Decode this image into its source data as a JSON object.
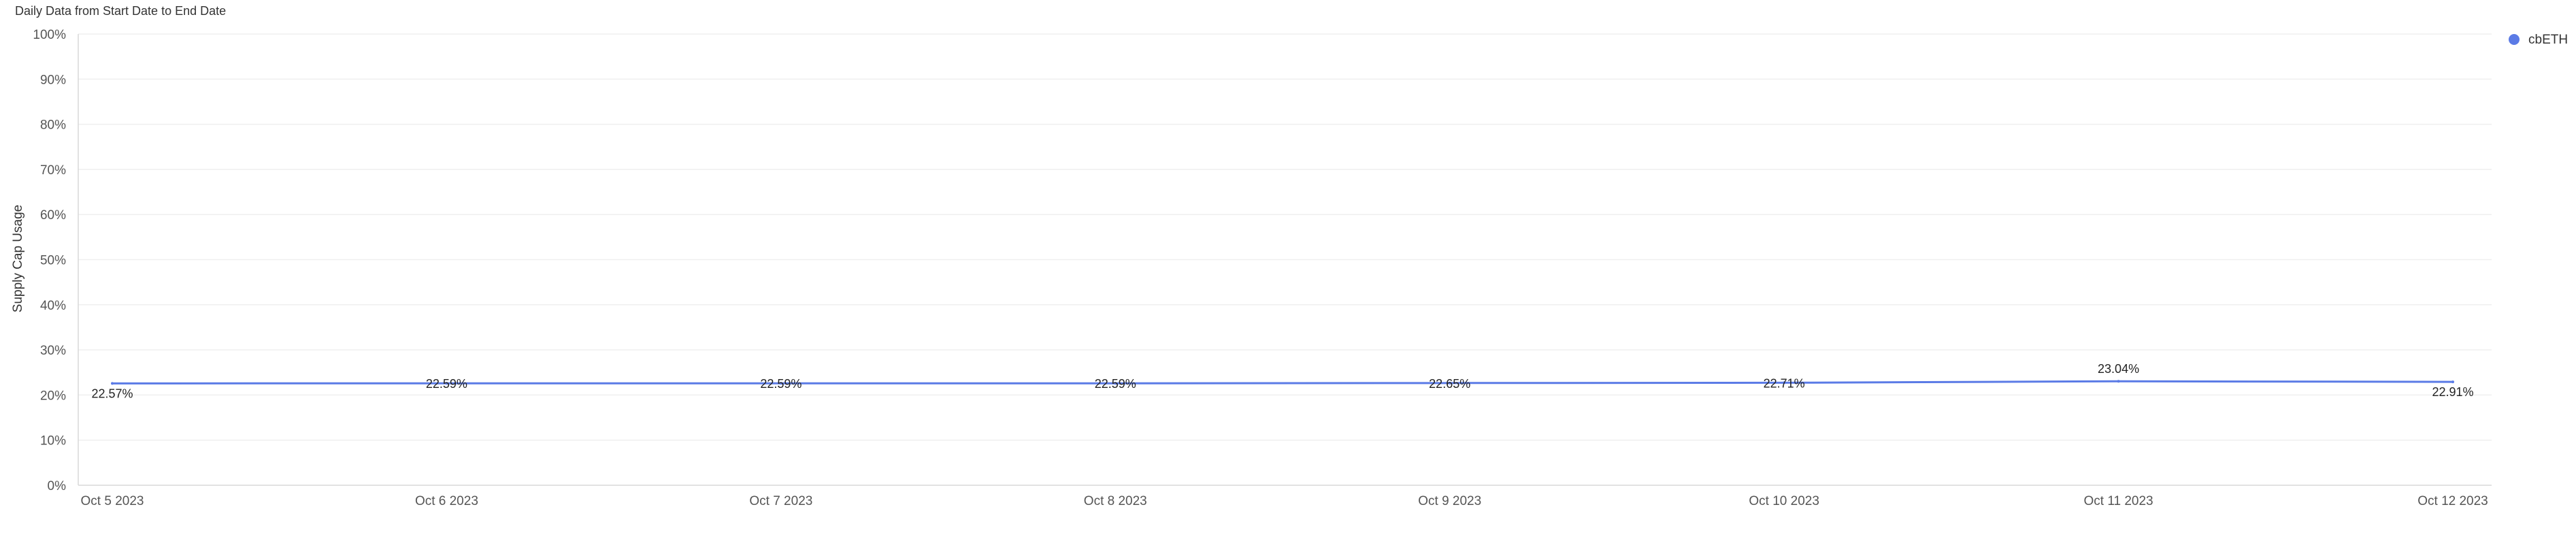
{
  "header": {
    "title": "Daily Data from Start Date to End Date"
  },
  "chart_data": {
    "type": "line",
    "title": "Daily Data from Start Date to End Date",
    "xlabel": "",
    "ylabel": "Supply Cap Usage",
    "categories": [
      "Oct 5 2023",
      "Oct 6 2023",
      "Oct 7 2023",
      "Oct 8 2023",
      "Oct 9 2023",
      "Oct 10 2023",
      "Oct 11 2023",
      "Oct 12 2023"
    ],
    "series": [
      {
        "name": "cbETH",
        "color": "#5b7be6",
        "values": [
          22.57,
          22.59,
          22.59,
          22.59,
          22.65,
          22.71,
          23.04,
          22.91
        ],
        "labels": [
          "22.57%",
          "22.59%",
          "22.59%",
          "22.59%",
          "22.65%",
          "22.71%",
          "23.04%",
          "22.91%"
        ]
      }
    ],
    "ylim": [
      0,
      100
    ],
    "yticks": [
      "0%",
      "10%",
      "20%",
      "30%",
      "40%",
      "50%",
      "60%",
      "70%",
      "80%",
      "90%",
      "100%"
    ],
    "grid": true,
    "legend_position": "top-right"
  }
}
